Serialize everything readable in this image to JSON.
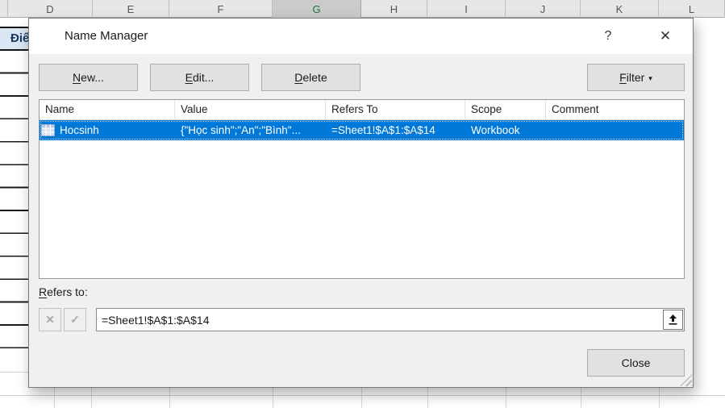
{
  "spreadsheet": {
    "column_headers": [
      "D",
      "E",
      "F",
      "G",
      "H",
      "I",
      "J",
      "K",
      "L"
    ],
    "selected_column": "G",
    "left_column_header": "Điể"
  },
  "dialog": {
    "title": "Name Manager",
    "icons": {
      "help": "?",
      "close": "✕",
      "filter_arrow": "▾",
      "cancel": "✕",
      "confirm": "✓"
    },
    "buttons": {
      "new_ak": "N",
      "new_rest": "ew...",
      "edit_ak": "E",
      "edit_rest": "dit...",
      "delete_ak": "D",
      "delete_rest": "elete",
      "filter_ak": "F",
      "filter_rest": "ilter",
      "close": "Close"
    },
    "table": {
      "headers": [
        "Name",
        "Value",
        "Refers To",
        "Scope",
        "Comment"
      ],
      "row": {
        "name": "Hocsinh",
        "value": "{\"Học sinh\";\"An\";\"Bình\"...",
        "refers_to": "=Sheet1!$A$1:$A$14",
        "scope": "Workbook",
        "comment": ""
      }
    },
    "refers_to": {
      "label_ak": "R",
      "label_rest": "efers to:",
      "value": "=Sheet1!$A$1:$A$14"
    }
  },
  "colors": {
    "selection_blue": "#0078D7",
    "selected_column_green": "#1F7246"
  }
}
